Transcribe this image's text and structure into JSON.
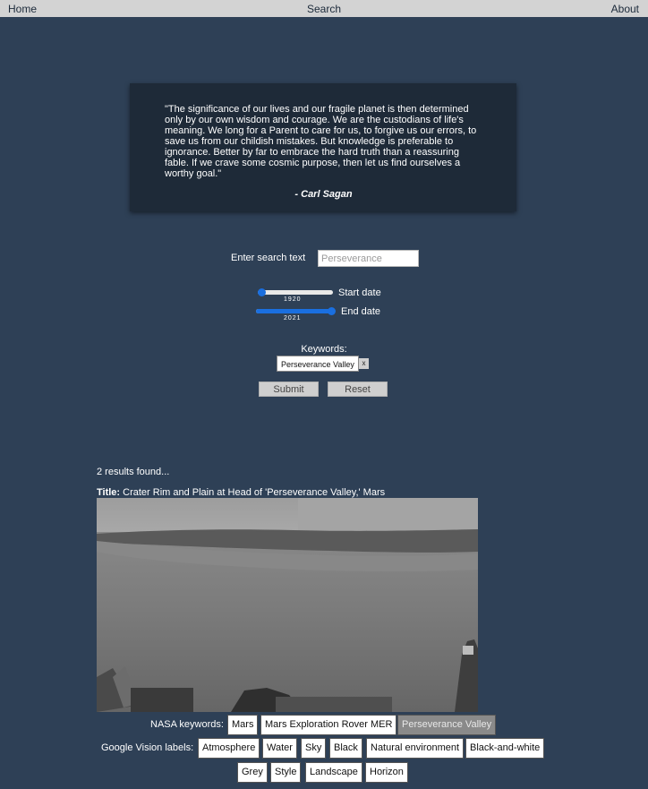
{
  "nav": {
    "home": "Home",
    "search": "Search",
    "about": "About"
  },
  "quote": {
    "text": "\"The significance of our lives and our fragile planet is then determined only by our own wisdom and courage. We are the custodians of life's meaning. We long for a Parent to care for us, to forgive us our errors, to save us from our childish mistakes. But knowledge is preferable to ignorance. Better by far to embrace the hard truth than a reassuring fable. If we crave some cosmic purpose, then let us find ourselves a worthy goal.\"",
    "author": "- Carl Sagan"
  },
  "search": {
    "label": "Enter search text",
    "placeholder": "Perseverance",
    "value": ""
  },
  "date_range": {
    "min": 1920,
    "max": 2021,
    "start": {
      "label": "Start date",
      "value": 1920
    },
    "end": {
      "label": "End date",
      "value": 2021
    }
  },
  "keywords": {
    "label": "Keywords:",
    "items": [
      {
        "label": "Perseverance Valley",
        "remove": "x"
      }
    ]
  },
  "buttons": {
    "submit": "Submit",
    "reset": "Reset"
  },
  "results": {
    "count_text": "2 results found...",
    "items": [
      {
        "title_label": "Title:",
        "title": "Crater Rim and Plain at Head of 'Perseverance Valley,' Mars",
        "nasa_label": "NASA keywords:",
        "nasa_keywords": [
          "Mars",
          "Mars Exploration Rover MER",
          "Perseverance Valley"
        ],
        "nasa_selected": "Perseverance Valley",
        "vision_label": "Google Vision labels:",
        "vision_labels": [
          "Atmosphere",
          "Water",
          "Sky",
          "Black",
          "Natural environment",
          "Black-and-white",
          "Grey",
          "Style",
          "Landscape",
          "Horizon"
        ]
      }
    ]
  }
}
